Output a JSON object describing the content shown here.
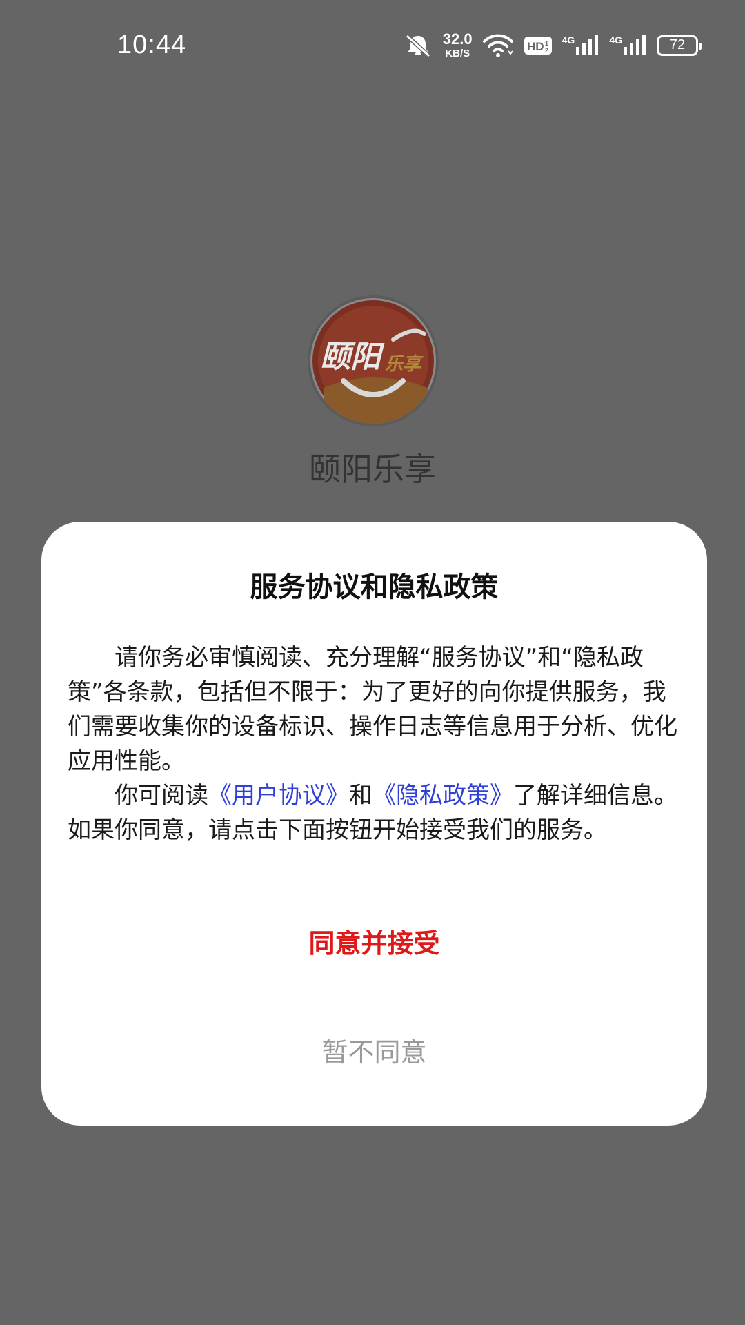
{
  "status_bar": {
    "time": "10:44",
    "net_speed_value": "32.0",
    "net_speed_unit": "KB/S",
    "hd_label": "HD",
    "network_1": "4G",
    "network_2": "4G",
    "battery": "72",
    "icons": [
      "mute-icon",
      "wifi-icon",
      "hd-icon",
      "signal-icon",
      "signal-icon",
      "battery-icon"
    ]
  },
  "app": {
    "name": "颐阳乐享",
    "logo_text_main": "颐阳",
    "logo_text_sub": "乐享"
  },
  "dialog": {
    "title": "服务协议和隐私政策",
    "para1": "请你务必审慎阅读、充分理解“服务协议”和“隐私政策”各条款，包括但不限于：为了更好的向你提供服务，我们需要收集你的设备标识、操作日志等信息用于分析、优化应用性能。",
    "para2_prefix": "你可阅读",
    "user_agreement_link": "《用户协议》",
    "para2_and": "和",
    "privacy_policy_link": "《隐私政策》",
    "para2_suffix": "了解详细信息。如果你同意，请点击下面按钮开始接受我们的服务。",
    "agree_label": "同意并接受",
    "decline_label": "暂不同意"
  },
  "colors": {
    "overlay": "#656565",
    "link": "#2f3fd8",
    "agree": "#e01818",
    "decline": "#9a9a9a"
  }
}
